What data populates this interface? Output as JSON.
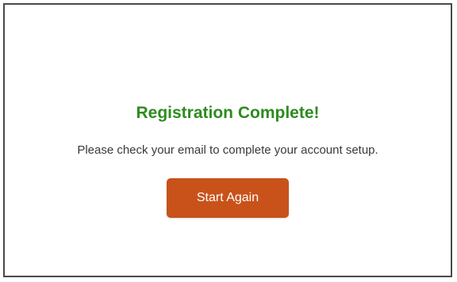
{
  "confirmation": {
    "title": "Registration Complete!",
    "message": "Please check your email to complete your account setup.",
    "start_again_label": "Start Again"
  },
  "colors": {
    "title_green": "#2e8b1f",
    "button_orange": "#c8521a",
    "border_gray": "#4a4a4a"
  }
}
